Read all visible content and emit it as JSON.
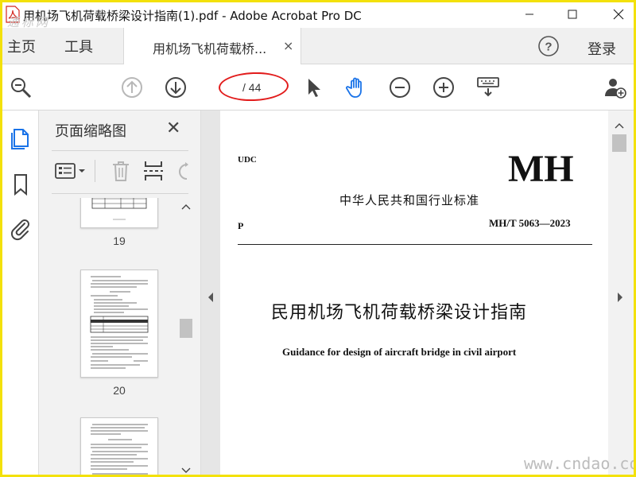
{
  "window": {
    "title": "用机场飞机荷载桥梁设计指南(1).pdf - Adobe Acrobat Pro DC",
    "watermark_top": "通标网"
  },
  "menu": {
    "home": "主页",
    "tools": "工具",
    "login": "登录"
  },
  "tab": {
    "label": "用机场飞机荷载桥...",
    "close": "×"
  },
  "toolbar": {
    "page_current": "",
    "page_total": "/ 44"
  },
  "thumbnail_panel": {
    "title": "页面缩略图",
    "close": "✕",
    "pages": [
      {
        "label": "19"
      },
      {
        "label": "20"
      },
      {
        "label": ""
      }
    ]
  },
  "document": {
    "udc": "UDC",
    "code": "MH",
    "industry_standard": "中华人民共和国行业标准",
    "p_mark": "P",
    "standard_number": "MH/T 5063—2023",
    "title_cn": "民用机场飞机荷载桥梁设计指南",
    "title_en": "Guidance for design of aircraft bridge in civil airport"
  },
  "watermark_bottom": "www.cndao.com",
  "colors": {
    "frame": "#f3e10a",
    "accent_blue": "#1a73e8",
    "annotation_red": "#e21c1c"
  },
  "icons": [
    "acrobat-icon",
    "minimize-icon",
    "maximize-icon",
    "close-icon",
    "help-icon",
    "zoom-icon",
    "prev-page-icon",
    "next-page-icon",
    "select-arrow-icon",
    "hand-icon",
    "zoom-out-icon",
    "zoom-in-icon",
    "keyboard-icon",
    "add-user-icon",
    "pages-icon",
    "bookmark-icon",
    "attachment-icon",
    "thumbnail-options-icon",
    "trash-icon",
    "insert-page-icon",
    "rotate-icon"
  ]
}
